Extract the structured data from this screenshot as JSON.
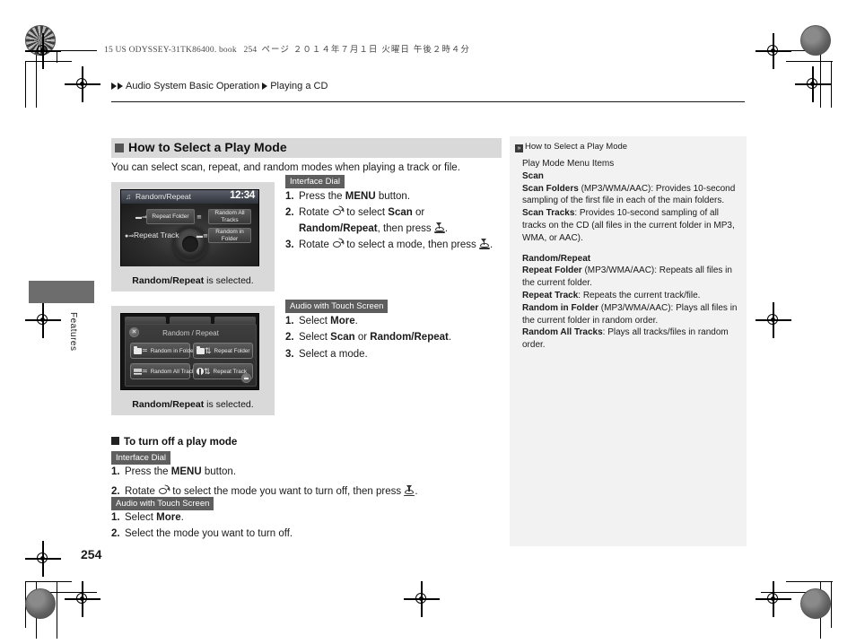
{
  "print_header": {
    "book_line_latin": "15 US ODYSSEY-31TK86400. book",
    "book_line_page": "254",
    "book_line_jp": "ページ   ２０１４年７月１日   火曜日   午後２時４分"
  },
  "breadcrumb": {
    "level1": "Audio System Basic Operation",
    "level2": "Playing a CD"
  },
  "side_tab": {
    "label": "Features"
  },
  "page_number": "254",
  "main": {
    "heading": "How to Select a Play Mode",
    "intro": "You can select scan, repeat, and random modes when playing a track or file.",
    "figure1": {
      "caption_bold": "Random/Repeat",
      "caption_rest": " is selected.",
      "title": "Random/Repeat",
      "clock": "12:34",
      "buttons": {
        "repeat_folder": "Repeat Folder",
        "random_all_tracks": "Random All Tracks",
        "repeat_track": "Repeat Track",
        "random_in_folder": "Random in Folder"
      }
    },
    "figure2": {
      "caption_bold": "Random/Repeat",
      "caption_rest": " is selected.",
      "title": "Random / Repeat",
      "buttons": {
        "random_in_folder": "Random in Folder",
        "repeat_folder": "Repeat  Folder",
        "random_all_tracks": "Random All Tracks",
        "repeat_track": "Repeat  Track"
      }
    },
    "tag_interface_dial": "Interface Dial",
    "tag_touch_screen": "Audio with Touch Screen",
    "steps_dial": [
      {
        "n": "1.",
        "pre": "Press the ",
        "b1": "MENU",
        "post": " button."
      },
      {
        "n": "2.",
        "pre": "Rotate ",
        "mid": " to select ",
        "b1": "Scan",
        "mid2": " or ",
        "b2": "Random/",
        "b3": "Repeat",
        "post": ", then press ",
        "end": "."
      },
      {
        "n": "3.",
        "pre": "Rotate ",
        "mid": " to select a mode, then press ",
        "end": "."
      }
    ],
    "steps_touch": [
      {
        "n": "1.",
        "pre": "Select ",
        "b1": "More",
        "post": "."
      },
      {
        "n": "2.",
        "pre": "Select ",
        "b1": "Scan",
        "mid": " or ",
        "b2": "Random/Repeat",
        "post": "."
      },
      {
        "n": "3.",
        "pre": "Select a mode."
      }
    ],
    "subheading": "To turn off a play mode",
    "off_tag_dial": "Interface Dial",
    "off_tag_touch": "Audio with Touch Screen",
    "off_steps_dial": [
      {
        "n": "1.",
        "pre": "Press the ",
        "b1": "MENU",
        "post": " button."
      },
      {
        "n": "2.",
        "pre": "Rotate ",
        "mid": " to select the mode you want to turn off, then press ",
        "end": "."
      }
    ],
    "off_steps_touch": [
      {
        "n": "1.",
        "pre": "Select ",
        "b1": "More",
        "post": "."
      },
      {
        "n": "2.",
        "pre": "Select the mode you want to turn off."
      }
    ]
  },
  "reference": {
    "title": "How to Select a Play Mode",
    "subtitle": "Play Mode Menu Items",
    "group1_heading": "Scan",
    "g1_i1_term": "Scan Folders",
    "g1_i1_text": " (MP3/WMA/AAC): Provides 10-second sampling of the first file in each of the main folders.",
    "g1_i2_term": "Scan Tracks",
    "g1_i2_text": ": Provides 10-second sampling of all tracks on the CD (all files in the current folder in MP3, WMA, or AAC).",
    "group2_heading": "Random/Repeat",
    "g2_i1_term": "Repeat Folder",
    "g2_i1_text": " (MP3/WMA/AAC): Repeats all files in the current folder.",
    "g2_i2_term": "Repeat Track",
    "g2_i2_text": ": Repeats the current track/file.",
    "g2_i3_term": "Random in Folder",
    "g2_i3_text": " (MP3/WMA/AAC): Plays all files in the current folder in random order.",
    "g2_i4_term": "Random All Tracks",
    "g2_i4_text": ": Plays all tracks/files in random order."
  },
  "colors": {
    "heading_band": "#d9d9d9",
    "tag_bg": "#5e5e5e",
    "panel_bg": "#f2f2f2",
    "side_tab": "#6d6d6d"
  }
}
